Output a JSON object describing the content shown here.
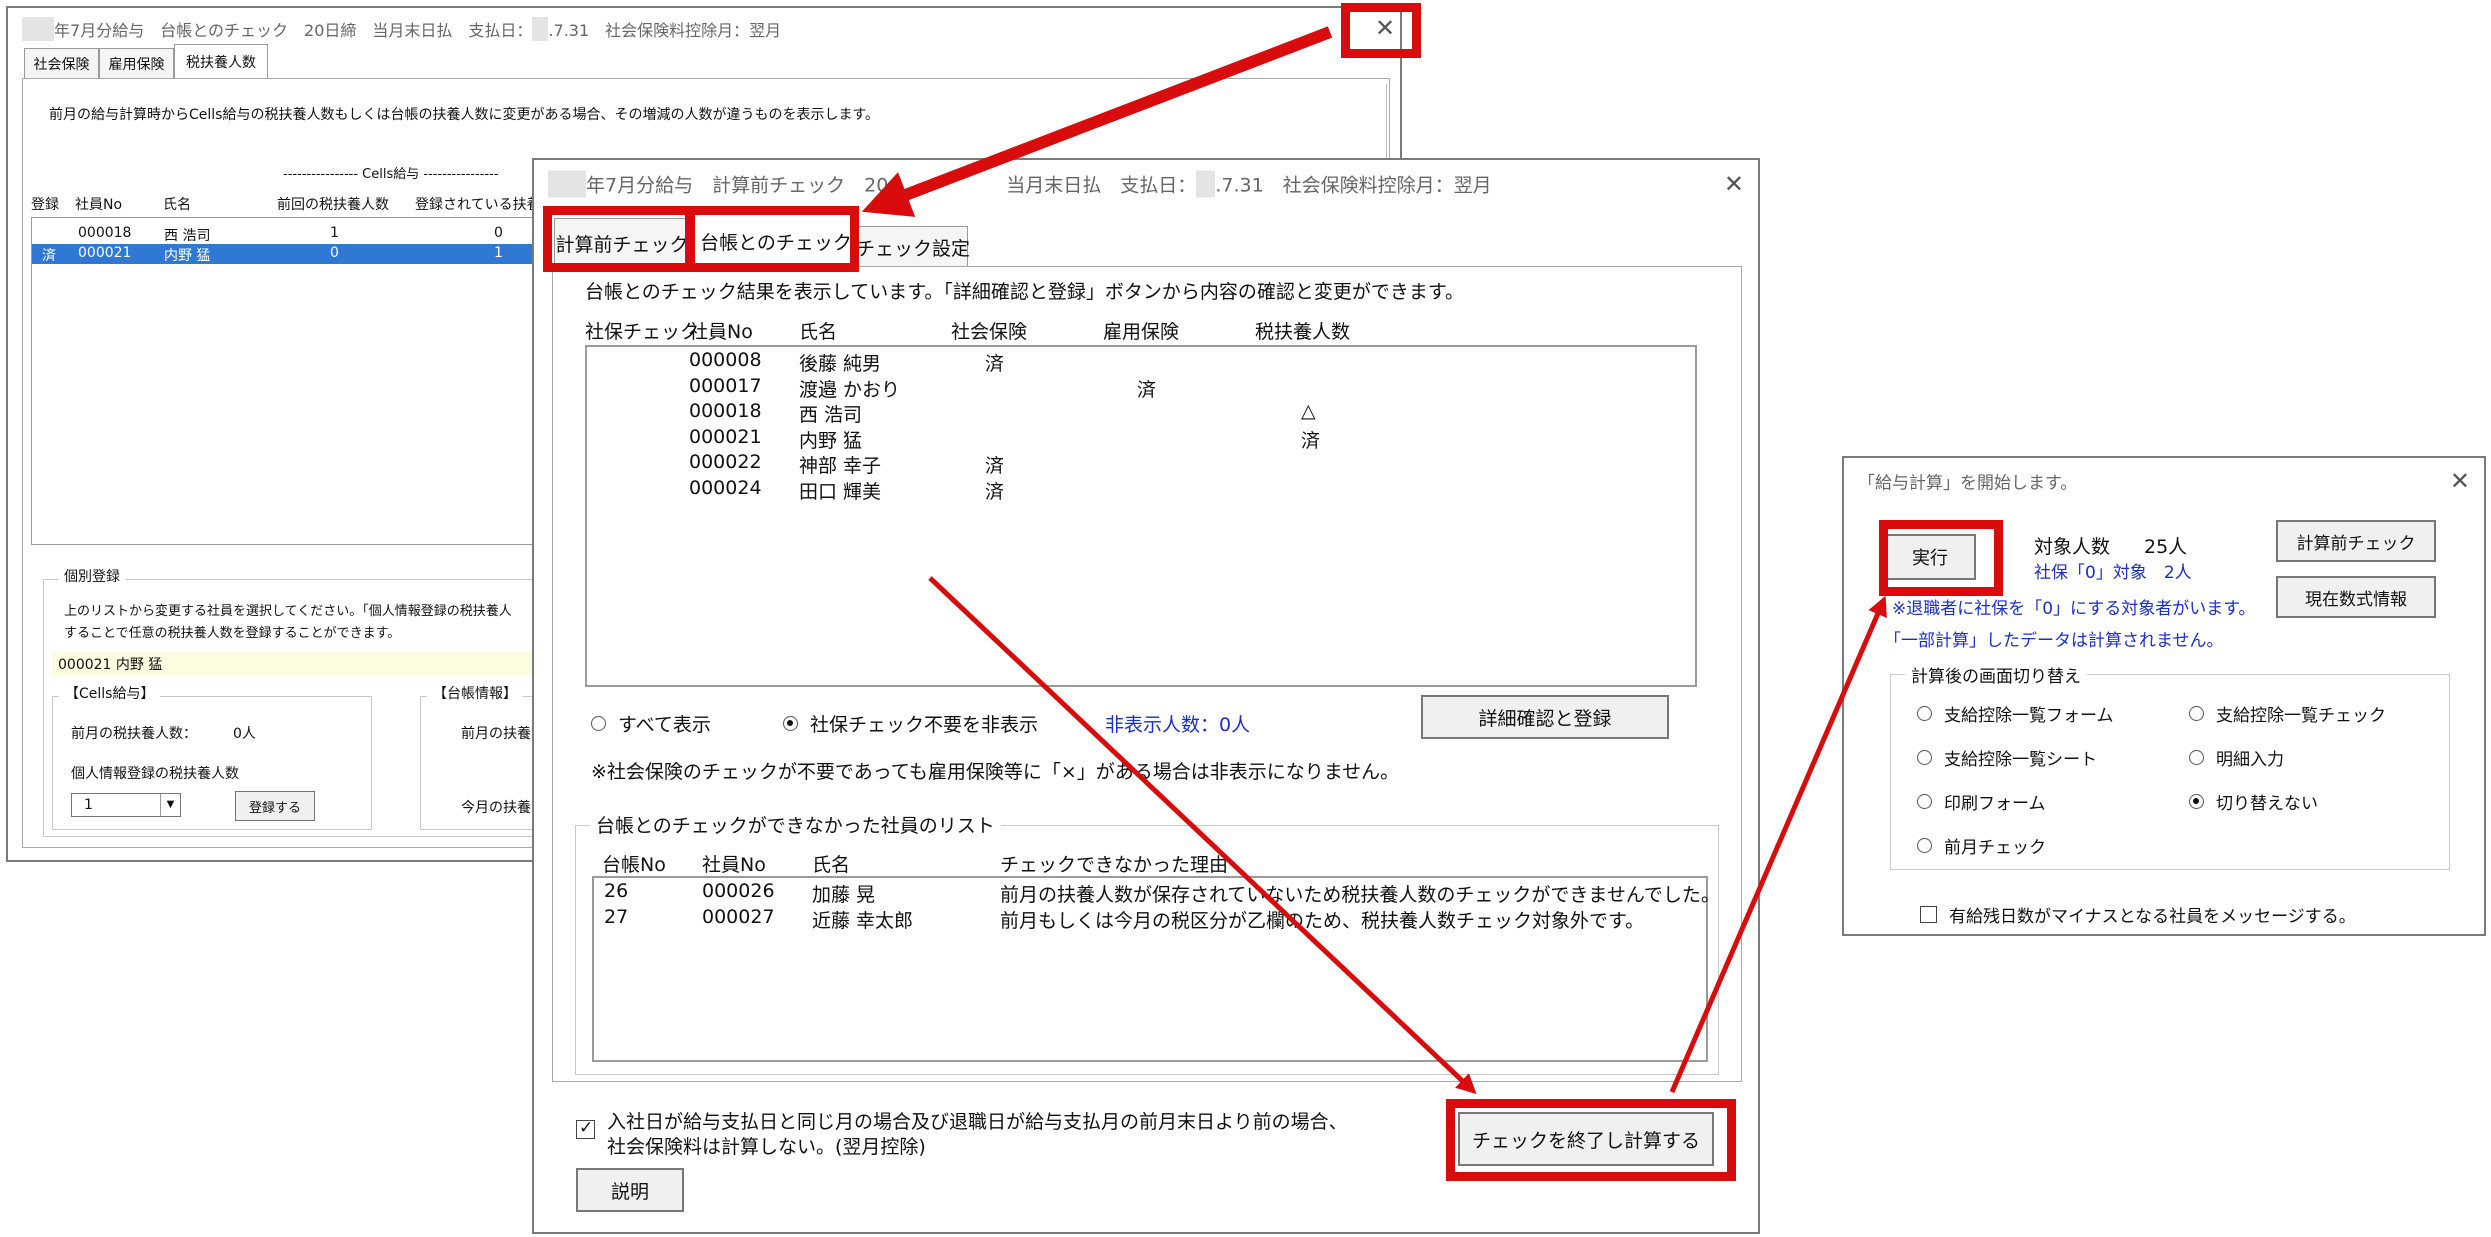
{
  "left_window": {
    "title_year": "　　",
    "title": "年7月分給与　台帳とのチェック　20日締　当月末日払　支払日：",
    "title_date": "　",
    "title_tail": ".7.31　社会保険料控除月：翌月",
    "tabs": [
      "社会保険",
      "雇用保険",
      "税扶養人数"
    ],
    "description": "前月の給与計算時からCells給与の税扶養人数もしくは台帳の扶養人数に変更がある場合、その増減の人数が違うものを表示します。",
    "cells_header": "---------------- Cells給与 ----------------",
    "columns": [
      "登録",
      "社員No",
      "氏名",
      "前回の税扶養人数",
      "登録されている扶養"
    ],
    "rows": [
      {
        "reg": "",
        "no": "000018",
        "name": "西 浩司",
        "prev": "1",
        "current": "0",
        "selected": false
      },
      {
        "reg": "済",
        "no": "000021",
        "name": "内野 猛",
        "prev": "0",
        "current": "1",
        "selected": true
      }
    ],
    "individual_legend": "個別登録",
    "individual_text_1": "上のリストから変更する社員を選択してください。「個人情報登録の税扶養人",
    "individual_text_2": "することで任意の税扶養人数を登録することができます。",
    "selected_employee": "000021 内野 猛",
    "cells_group_legend": "【Cells給与】",
    "prev_tax_label": "前月の税扶養人数：",
    "prev_tax_value": "0人",
    "personal_tax_label": "個人情報登録の税扶養人数",
    "dropdown_value": "1",
    "register_button": "登録する",
    "ledger_group_legend": "【台帳情報】",
    "ledger_prev_label": "前月の扶養",
    "ledger_current_label": "今月の扶養"
  },
  "center_window": {
    "title_year": "　　",
    "title_a": "年7月分給与　計算前チェック　20",
    "title_b": "当月末日払　支払日：",
    "title_date": "　",
    "title_c": ".7.31　社会保険料控除月：翌月",
    "tabs": [
      "計算前チェック",
      "台帳とのチェック",
      "チェック設定"
    ],
    "info": "台帳とのチェック結果を表示しています。「詳細確認と登録」ボタンから内容の確認と変更ができます。",
    "columns": [
      "社保チェック",
      "社員No",
      "氏名",
      "社会保険",
      "雇用保険",
      "税扶養人数"
    ],
    "rows": [
      {
        "no": "000008",
        "name": "後藤 純男",
        "social": "済",
        "employment": "",
        "tax": ""
      },
      {
        "no": "000017",
        "name": "渡邉 かおり",
        "social": "",
        "employment": "済",
        "tax": ""
      },
      {
        "no": "000018",
        "name": "西 浩司",
        "social": "",
        "employment": "",
        "tax": "△"
      },
      {
        "no": "000021",
        "name": "内野 猛",
        "social": "",
        "employment": "",
        "tax": "済"
      },
      {
        "no": "000022",
        "name": "神部 幸子",
        "social": "済",
        "employment": "",
        "tax": ""
      },
      {
        "no": "000024",
        "name": "田口 輝美",
        "social": "済",
        "employment": "",
        "tax": ""
      }
    ],
    "radio_all": "すべて表示",
    "radio_hide": "社保チェック不要を非表示",
    "hidden_count": "非表示人数：0人",
    "detail_button": "詳細確認と登録",
    "note": "※社会保険のチェックが不要であっても雇用保険等に「×」がある場合は非表示になりません。",
    "unchecked_legend": "台帳とのチェックができなかった社員のリスト",
    "unchecked_columns": [
      "台帳No",
      "社員No",
      "氏名",
      "チェックできなかった理由"
    ],
    "unchecked_rows": [
      {
        "ledger": "26",
        "no": "000026",
        "name": "加藤 晃",
        "reason": "前月の扶養人数が保存されていないため税扶養人数のチェックができませんでした。"
      },
      {
        "ledger": "27",
        "no": "000027",
        "name": "近藤 幸太郎",
        "reason": "前月もしくは今月の税区分が乙欄のため、税扶養人数チェック対象外です。"
      }
    ],
    "bottom_check_1": "入社日が給与支払日と同じ月の場合及び退職日が給与支払月の前月末日より前の場合、",
    "bottom_check_2": "社会保険料は計算しない。(翌月控除)",
    "explain_button": "説明",
    "finish_button": "チェックを終了し計算する"
  },
  "right_window": {
    "title": "「給与計算」を開始します。",
    "run_button": "実行",
    "target_label": "対象人数",
    "target_value": "25人",
    "shaho_zero": "社保「0」対象　2人",
    "precheck_button": "計算前チェック",
    "formula_button": "現在数式情報",
    "warn_1": "※退職者に社保を「0」にする対象者がいます。",
    "warn_2": "「一部計算」したデータは計算されません。",
    "switch_legend": "計算後の画面切り替え",
    "options": [
      "支給控除一覧フォーム",
      "支給控除一覧チェック",
      "支給控除一覧シート",
      "明細入力",
      "印刷フォーム",
      "切り替えない",
      "前月チェック"
    ],
    "selected_option": "切り替えない",
    "paid_leave_check": "有給残日数がマイナスとなる社員をメッセージする。"
  },
  "colors": {
    "highlight_red": "#d80c0c",
    "selection_blue": "#2f78d3",
    "info_blue": "#1a2fc8"
  }
}
